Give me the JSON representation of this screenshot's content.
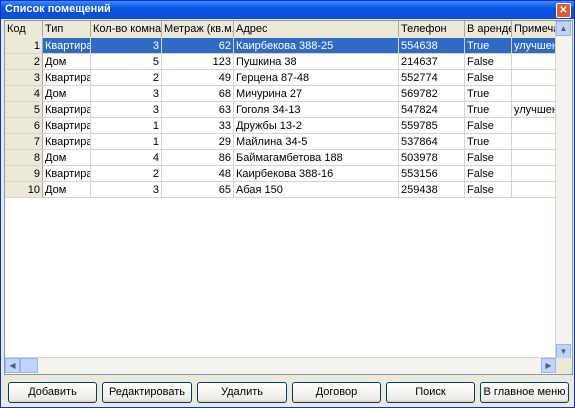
{
  "window": {
    "title": "Список помещений",
    "close_glyph": "✕"
  },
  "columns": [
    "Код",
    "Тип",
    "Кол-во комнат",
    "Метраж (кв.м.)",
    "Адрес",
    "Телефон",
    "В аренде",
    "Примечан"
  ],
  "rows": [
    {
      "code": "1",
      "type": "Квартира",
      "rooms": "3",
      "area": "62",
      "address": "Каирбекова 388-25",
      "phone": "554638",
      "rented": "True",
      "note": "улучшенно"
    },
    {
      "code": "2",
      "type": "Дом",
      "rooms": "5",
      "area": "123",
      "address": "Пушкина 38",
      "phone": "214637",
      "rented": "False",
      "note": ""
    },
    {
      "code": "3",
      "type": "Квартира",
      "rooms": "2",
      "area": "49",
      "address": "Герцена 87-48",
      "phone": "552774",
      "rented": "False",
      "note": ""
    },
    {
      "code": "4",
      "type": "Дом",
      "rooms": "3",
      "area": "68",
      "address": "Мичурина 27",
      "phone": "569782",
      "rented": "True",
      "note": ""
    },
    {
      "code": "5",
      "type": "Квартира",
      "rooms": "3",
      "area": "63",
      "address": "Гоголя 34-13",
      "phone": "547824",
      "rented": "True",
      "note": "улучшенно"
    },
    {
      "code": "6",
      "type": "Квартира",
      "rooms": "1",
      "area": "33",
      "address": "Дружбы 13-2",
      "phone": "559785",
      "rented": "False",
      "note": ""
    },
    {
      "code": "7",
      "type": "Квартира",
      "rooms": "1",
      "area": "29",
      "address": "Майлина 34-5",
      "phone": "537864",
      "rented": "True",
      "note": ""
    },
    {
      "code": "8",
      "type": "Дом",
      "rooms": "4",
      "area": "86",
      "address": "Баймагамбетова 188",
      "phone": "503978",
      "rented": "False",
      "note": ""
    },
    {
      "code": "9",
      "type": "Квартира",
      "rooms": "2",
      "area": "48",
      "address": "Каирбекова 388-16",
      "phone": "553156",
      "rented": "False",
      "note": ""
    },
    {
      "code": "10",
      "type": "Дом",
      "rooms": "3",
      "area": "65",
      "address": "Абая 150",
      "phone": "259438",
      "rented": "False",
      "note": ""
    }
  ],
  "selected_row": 0,
  "buttons": {
    "add": "Добавить",
    "edit": "Редактировать",
    "delete": "Удалить",
    "contract": "Договор",
    "search": "Поиск",
    "main_menu": "В главное меню"
  },
  "scroll_glyphs": {
    "up": "▲",
    "down": "▼",
    "left": "◀",
    "right": "▶"
  }
}
